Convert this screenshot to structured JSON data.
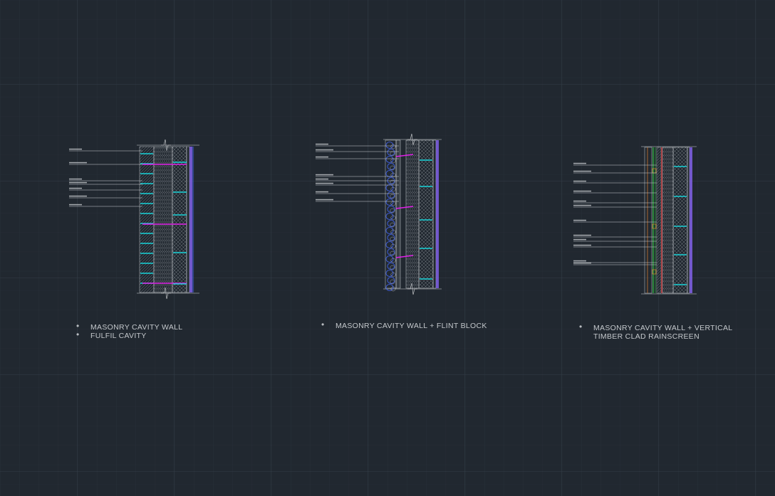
{
  "colors": {
    "background": "#212830",
    "grid_minor": "#2a323c",
    "grid_major": "#333c47",
    "line_white": "#d8dadc",
    "cyan": "#19d3d8",
    "magenta": "#e020e8",
    "purple": "#8060e8",
    "blue": "#4060e0",
    "green": "#30c040",
    "red": "#e02020",
    "orange": "#e08030"
  },
  "sections": [
    {
      "id": "fulfil",
      "captions": [
        "MASONRY CAVITY WALL",
        "FULFIL CAVITY"
      ],
      "labels": [
        "",
        "",
        "",
        "",
        "",
        "",
        ""
      ]
    },
    {
      "id": "flint",
      "captions": [
        "MASONRY CAVITY WALL  + FLINT BLOCK"
      ],
      "labels": [
        "",
        "",
        "",
        "",
        "",
        "",
        "",
        ""
      ]
    },
    {
      "id": "timber",
      "captions": [
        "MASONRY CAVITY WALL + VERTICAL",
        "TIMBER CLAD RAINSCREEN"
      ],
      "labels": [
        "",
        "",
        "",
        "",
        "",
        "",
        "",
        "",
        "",
        "",
        "",
        ""
      ]
    }
  ]
}
